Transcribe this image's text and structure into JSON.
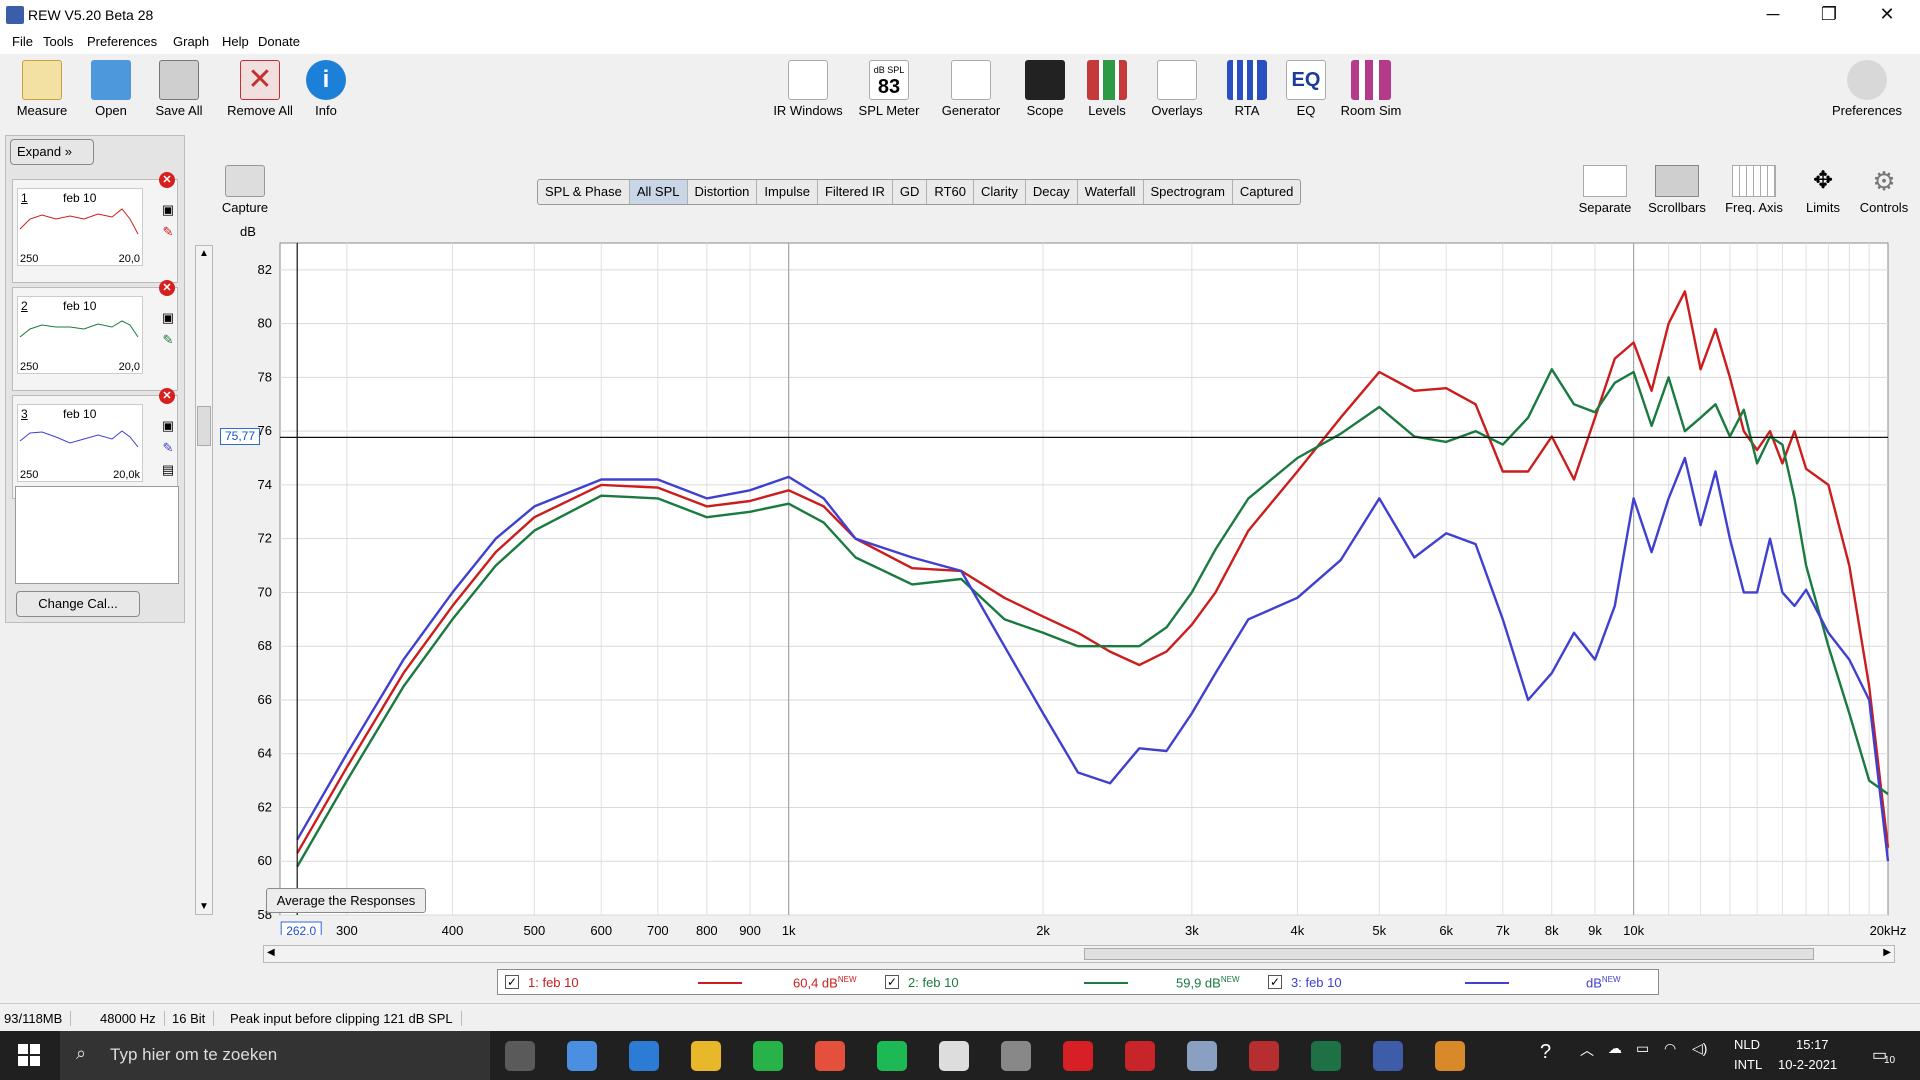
{
  "window": {
    "title": "REW V5.20 Beta 28",
    "minimize": "─",
    "restore": "❐",
    "close": "✕"
  },
  "menu": [
    "File",
    "Tools",
    "Preferences",
    "Graph",
    "Help",
    "Donate"
  ],
  "toolbar_left": [
    {
      "label": "Measure",
      "icon": "measure-icon",
      "color": "#e8b03c"
    },
    {
      "label": "Open",
      "icon": "folder-icon",
      "color": "#3f8fd6"
    },
    {
      "label": "Save All",
      "icon": "save-icon",
      "color": "#777777"
    },
    {
      "label": "Remove All",
      "icon": "remove-icon",
      "color": "#c23030"
    },
    {
      "label": "Info",
      "icon": "info-icon",
      "color": "#1c7fd8"
    }
  ],
  "toolbar_center": [
    {
      "label": "IR Windows",
      "icon": "ir-windows-icon",
      "color": "#c63a3a"
    },
    {
      "label": "SPL Meter",
      "icon": "spl-meter-icon",
      "color": "#222222",
      "top": "dB SPL",
      "value": "83"
    },
    {
      "label": "Generator",
      "icon": "generator-icon",
      "color": "#2a59c9"
    },
    {
      "label": "Scope",
      "icon": "scope-icon",
      "color": "#222222"
    },
    {
      "label": "Levels",
      "icon": "levels-icon",
      "color": "#c43a3a"
    },
    {
      "label": "Overlays",
      "icon": "overlays-icon",
      "color": "#c43a3a"
    },
    {
      "label": "RTA",
      "icon": "rta-icon",
      "color": "#2a4fc0"
    },
    {
      "label": "EQ",
      "icon": "eq-icon",
      "color": "#1b3c9a"
    },
    {
      "label": "Room Sim",
      "icon": "room-sim-icon",
      "color": "#b63a8a"
    }
  ],
  "preferences": {
    "label": "Preferences",
    "icon": "wrench-icon"
  },
  "left_panel": {
    "expand": "Expand",
    "change_cal": "Change Cal...",
    "measurements": [
      {
        "num": "1",
        "name": "feb 10",
        "lo": "250",
        "hi": "20,0",
        "color": "#cc1d1d"
      },
      {
        "num": "2",
        "name": "feb 10",
        "lo": "250",
        "hi": "20,0",
        "color": "#1a7a3f"
      },
      {
        "num": "3",
        "name": "feb 10",
        "lo": "250",
        "hi": "20,0k",
        "color": "#4040d0"
      }
    ]
  },
  "capture": {
    "label": "Capture",
    "icon": "camera-icon"
  },
  "tabs": [
    {
      "label": "SPL & Phase",
      "selected": false
    },
    {
      "label": "All SPL",
      "selected": true
    },
    {
      "label": "Distortion",
      "selected": false
    },
    {
      "label": "Impulse",
      "selected": false
    },
    {
      "label": "Filtered IR",
      "selected": false
    },
    {
      "label": "GD",
      "selected": false
    },
    {
      "label": "RT60",
      "selected": false
    },
    {
      "label": "Clarity",
      "selected": false
    },
    {
      "label": "Decay",
      "selected": false
    },
    {
      "label": "Waterfall",
      "selected": false
    },
    {
      "label": "Spectrogram",
      "selected": false
    },
    {
      "label": "Captured",
      "selected": false
    }
  ],
  "graph_tools": [
    {
      "label": "Separate",
      "icon": "separate-icon"
    },
    {
      "label": "Scrollbars",
      "icon": "scrollbars-icon"
    },
    {
      "label": "Freq. Axis",
      "icon": "freq-axis-icon"
    },
    {
      "label": "Limits",
      "icon": "limits-icon"
    },
    {
      "label": "Controls",
      "icon": "controls-icon"
    }
  ],
  "graph": {
    "cursor_db": "75,77",
    "cursor_hz": "262,0",
    "average_button": "Average the Responses"
  },
  "chart_data": {
    "type": "line",
    "xlabel": "",
    "ylabel": "dB",
    "xscale": "log",
    "xlim": [
      250,
      20000
    ],
    "ylim": [
      58,
      83
    ],
    "y_ticks": [
      58,
      60,
      62,
      64,
      66,
      68,
      70,
      72,
      74,
      76,
      78,
      80,
      82
    ],
    "x_ticks": [
      {
        "v": 262,
        "t": "2"
      },
      {
        "v": 300,
        "t": "300"
      },
      {
        "v": 400,
        "t": "400"
      },
      {
        "v": 500,
        "t": "500"
      },
      {
        "v": 600,
        "t": "600"
      },
      {
        "v": 700,
        "t": "700"
      },
      {
        "v": 800,
        "t": "800"
      },
      {
        "v": 900,
        "t": "900"
      },
      {
        "v": 1000,
        "t": "1k"
      },
      {
        "v": 2000,
        "t": "2k"
      },
      {
        "v": 3000,
        "t": "3k"
      },
      {
        "v": 4000,
        "t": "4k"
      },
      {
        "v": 5000,
        "t": "5k"
      },
      {
        "v": 6000,
        "t": "6k"
      },
      {
        "v": 7000,
        "t": "7k"
      },
      {
        "v": 8000,
        "t": "8k"
      },
      {
        "v": 9000,
        "t": "9k"
      },
      {
        "v": 10000,
        "t": "10k"
      },
      {
        "v": 20000,
        "t": "20kHz"
      }
    ],
    "cursor": {
      "x": 262,
      "y": 75.77
    },
    "grid": true,
    "series": [
      {
        "name": "1: feb 10",
        "color": "#cc1d1d",
        "x": [
          262,
          300,
          350,
          400,
          450,
          500,
          600,
          700,
          800,
          900,
          1000,
          1100,
          1200,
          1400,
          1600,
          1800,
          2000,
          2200,
          2400,
          2600,
          2800,
          3000,
          3200,
          3500,
          4000,
          4500,
          5000,
          5500,
          6000,
          6500,
          7000,
          7500,
          8000,
          8500,
          9000,
          9500,
          10000,
          10500,
          11000,
          11500,
          12000,
          12500,
          13000,
          13500,
          14000,
          14500,
          15000,
          15500,
          16000,
          17000,
          18000,
          19000,
          20000
        ],
        "y": [
          60.3,
          63.5,
          67,
          69.5,
          71.5,
          72.8,
          74,
          73.9,
          73.2,
          73.4,
          73.8,
          73.2,
          72,
          70.9,
          70.8,
          69.8,
          69.1,
          68.5,
          67.8,
          67.3,
          67.8,
          68.8,
          70,
          72.3,
          74.5,
          76.5,
          78.2,
          77.5,
          77.6,
          77,
          74.5,
          74.5,
          75.8,
          74.2,
          76.5,
          78.7,
          79.3,
          77.5,
          80,
          81.2,
          78.3,
          79.8,
          78,
          76,
          75.3,
          76,
          74.8,
          76,
          74.6,
          74,
          71,
          66.5,
          60.5
        ]
      },
      {
        "name": "2: feb 10",
        "color": "#1a7a3f",
        "x": [
          262,
          300,
          350,
          400,
          450,
          500,
          600,
          700,
          800,
          900,
          1000,
          1100,
          1200,
          1400,
          1600,
          1800,
          2000,
          2200,
          2400,
          2600,
          2800,
          3000,
          3200,
          3500,
          4000,
          4500,
          5000,
          5500,
          6000,
          6500,
          7000,
          7500,
          8000,
          8500,
          9000,
          9500,
          10000,
          10500,
          11000,
          11500,
          12000,
          12500,
          13000,
          13500,
          14000,
          14500,
          15000,
          15500,
          16000,
          17000,
          18000,
          19000,
          20000
        ],
        "y": [
          59.8,
          63,
          66.5,
          69,
          71,
          72.3,
          73.6,
          73.5,
          72.8,
          73,
          73.3,
          72.6,
          71.3,
          70.3,
          70.5,
          69,
          68.5,
          68,
          68,
          68,
          68.7,
          70,
          71.6,
          73.5,
          75,
          75.9,
          76.9,
          75.8,
          75.6,
          76,
          75.5,
          76.5,
          78.3,
          77,
          76.7,
          77.8,
          78.2,
          76.2,
          78,
          76,
          76.5,
          77,
          75.8,
          76.8,
          74.8,
          75.8,
          75.5,
          73.5,
          71,
          68,
          65.5,
          63,
          62.5
        ]
      },
      {
        "name": "3: feb 10",
        "color": "#4040d0",
        "x": [
          262,
          300,
          350,
          400,
          450,
          500,
          600,
          700,
          800,
          900,
          1000,
          1100,
          1200,
          1400,
          1600,
          1800,
          2000,
          2200,
          2400,
          2600,
          2800,
          3000,
          3200,
          3500,
          4000,
          4500,
          5000,
          5500,
          6000,
          6500,
          7000,
          7500,
          8000,
          8500,
          9000,
          9500,
          10000,
          10500,
          11000,
          11500,
          12000,
          12500,
          13000,
          13500,
          14000,
          14500,
          15000,
          15500,
          16000,
          17000,
          18000,
          19000,
          20000
        ],
        "y": [
          60.8,
          64,
          67.5,
          70,
          72,
          73.2,
          74.2,
          74.2,
          73.5,
          73.8,
          74.3,
          73.5,
          72,
          71.3,
          70.8,
          68,
          65.5,
          63.3,
          62.9,
          64.2,
          64.1,
          65.5,
          67,
          69,
          69.8,
          71.2,
          73.5,
          71.3,
          72.2,
          71.8,
          69,
          66,
          67,
          68.5,
          67.5,
          69.5,
          73.5,
          71.5,
          73.5,
          75,
          72.5,
          74.5,
          72,
          70,
          70,
          72,
          70,
          69.5,
          70.1,
          68.5,
          67.5,
          66,
          60
        ]
      }
    ]
  },
  "legend": [
    {
      "check": "✓",
      "label": "1: feb 10",
      "value": "60,4 dB",
      "sup": "NEW",
      "color": "#cc1d1d"
    },
    {
      "check": "✓",
      "label": "2: feb 10",
      "value": "59,9 dB",
      "sup": "NEW",
      "color": "#1a7a3f"
    },
    {
      "check": "✓",
      "label": "3: feb 10",
      "value": "dB",
      "sup": "NEW",
      "color": "#4040d0"
    }
  ],
  "status": [
    "93/118MB",
    "48000 Hz",
    "16 Bit",
    "Peak input before clipping 121 dB SPL"
  ],
  "taskbar": {
    "search_placeholder": "Typ hier om te zoeken",
    "apps": [
      {
        "icon": "task-view-icon",
        "color": "#5a5a5a"
      },
      {
        "icon": "store-icon",
        "color": "#4a8fe0"
      },
      {
        "icon": "mail-icon",
        "color": "#2c7bd4"
      },
      {
        "icon": "explorer-icon",
        "color": "#e8b82a"
      },
      {
        "icon": "whatsapp-icon",
        "color": "#27b34a"
      },
      {
        "icon": "chrome-icon",
        "color": "#e4503b"
      },
      {
        "icon": "spotify-icon",
        "color": "#1db954"
      },
      {
        "icon": "search-app-icon",
        "color": "#dddddd"
      },
      {
        "icon": "app-b-icon",
        "color": "#888888"
      },
      {
        "icon": "netflix-icon",
        "color": "#d81f26"
      },
      {
        "icon": "sw-icon",
        "color": "#c8252a"
      },
      {
        "icon": "app-tools-icon",
        "color": "#8aa0c0"
      },
      {
        "icon": "sw-doc-icon",
        "color": "#b72e30"
      },
      {
        "icon": "excel-icon",
        "color": "#1e7145"
      },
      {
        "icon": "rew-icon",
        "color": "#3e5ca8"
      },
      {
        "icon": "app-wave-icon",
        "color": "#d88a2a"
      }
    ],
    "lang_top": "NLD",
    "lang_bottom": "INTL",
    "time": "15:17",
    "date": "10-2-2021",
    "notifications": "10"
  }
}
